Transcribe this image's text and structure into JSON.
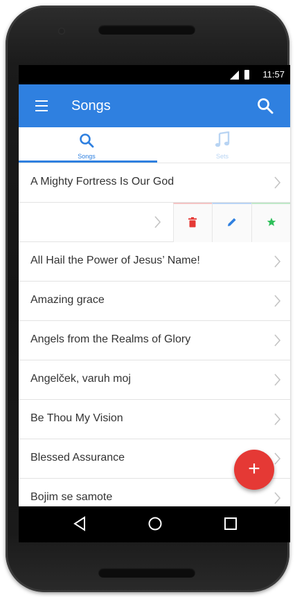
{
  "status_bar": {
    "time": "11:57"
  },
  "app_bar": {
    "title": "Songs",
    "menu_icon": "menu-icon",
    "search_icon": "search-icon"
  },
  "tabs": [
    {
      "label": "Songs",
      "icon": "search-icon",
      "active": true
    },
    {
      "label": "Sets",
      "icon": "music-note-icon",
      "active": false
    }
  ],
  "songs": [
    "A Mighty Fortress Is Our God",
    "",
    "All Hail the Power of Jesus’ Name!",
    "Amazing grace",
    "Angels from the Realms of Glory",
    "Angelček, varuh moj",
    "Be Thou My Vision",
    "Blessed Assurance",
    "Bojim se samote"
  ],
  "swipe_actions": {
    "delete_icon": "delete-icon",
    "edit_icon": "edit-icon",
    "favorite_icon": "star-icon"
  },
  "fab": {
    "label": "+"
  },
  "colors": {
    "primary": "#2f80e0",
    "fab": "#e53935",
    "delete": "#e53935",
    "edit": "#2f80e0",
    "favorite": "#2ec05a"
  }
}
